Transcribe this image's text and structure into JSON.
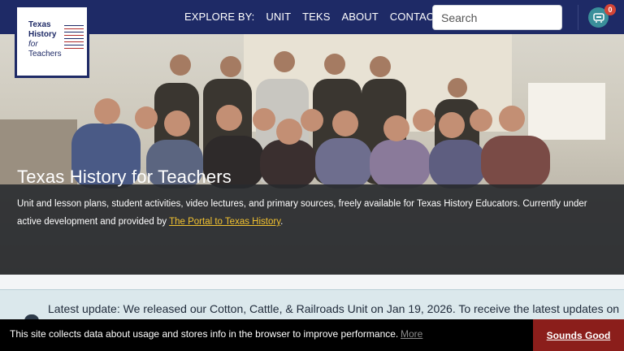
{
  "logo": {
    "line1": "Texas",
    "line2": "History",
    "line3": "for",
    "line4": "Teachers"
  },
  "nav": {
    "explore_label": "EXPLORE BY:",
    "items": [
      "UNIT",
      "TEKS",
      "ABOUT",
      "CONTACT US"
    ]
  },
  "search": {
    "placeholder": "Search"
  },
  "cart": {
    "count": "0"
  },
  "hero": {
    "title": "Texas History for Teachers",
    "description_part1": "Unit and lesson plans, student activities, video lectures, and primary sources, freely available for Texas History Educators. Currently under active development and provided by ",
    "link_text": "The Portal to Texas History",
    "description_part2": "."
  },
  "update": {
    "text": "Latest update: We released our Cotton, Cattle, & Railroads Unit on Jan 19, 2026. To receive the latest updates on"
  },
  "cookie": {
    "message": "This site collects data about usage and stores info in the browser to improve performance.",
    "more_label": "More",
    "accept_label": "Sounds Good"
  },
  "colors": {
    "header_bg": "#1e2a66",
    "link_yellow": "#f2c230",
    "cookie_button": "#8b1e1b",
    "cart_teal": "#3a8f9a",
    "badge_red": "#d44536"
  }
}
